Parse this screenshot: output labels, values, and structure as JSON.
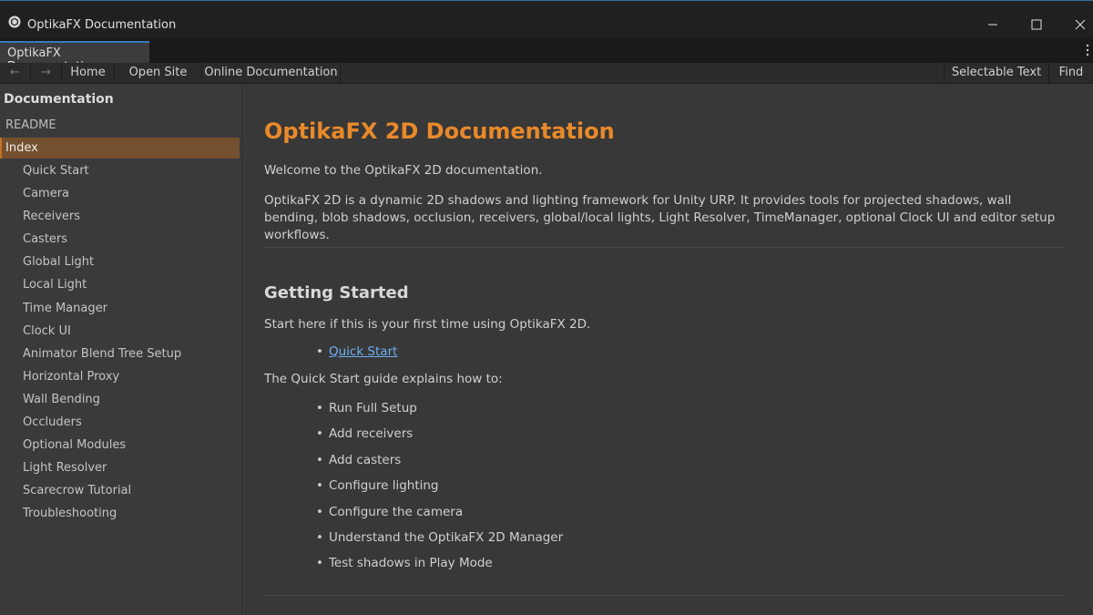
{
  "window": {
    "title": "OptikaFX Documentation",
    "icon": "unity-cube-icon"
  },
  "tab": {
    "label": "OptikaFX Documentation"
  },
  "toolbar": {
    "back_icon": "arrow-left-icon",
    "back_label": "←",
    "forward_icon": "arrow-right-icon",
    "forward_label": "→",
    "home_label": "Home",
    "open_site_label": "Open Site",
    "online_docs_label": "Online Documentation",
    "selectable_text_label": "Selectable Text",
    "find_label": "Find"
  },
  "sidebar": {
    "heading": "Documentation",
    "readme": "README",
    "selected": "Index",
    "items": [
      "Quick Start",
      "Camera",
      "Receivers",
      "Casters",
      "Global Light",
      "Local Light",
      "Time Manager",
      "Clock UI",
      "Animator Blend Tree Setup",
      "Horizontal Proxy",
      "Wall Bending",
      "Occluders",
      "Optional Modules",
      "Light Resolver",
      "Scarecrow Tutorial",
      "Troubleshooting"
    ]
  },
  "main": {
    "title": "OptikaFX 2D Documentation",
    "welcome": "Welcome to the OptikaFX 2D documentation.",
    "description": "OptikaFX 2D is a dynamic 2D shadows and lighting framework for Unity URP. It provides tools for projected shadows, wall bending, blob shadows, occlusion, receivers, global/local lights, Light Resolver, TimeManager, optional Clock UI and editor setup workflows.",
    "getting_started_heading": "Getting Started",
    "getting_started_text": "Start here if this is your first time using OptikaFX 2D.",
    "quick_start_link": "Quick Start",
    "guide_intro": "The Quick Start guide explains how to:",
    "steps": [
      "Run Full Setup",
      "Add receivers",
      "Add casters",
      "Configure lighting",
      "Configure the camera",
      "Understand the OptikaFX 2D Manager",
      "Test shadows in Play Mode"
    ]
  },
  "colors": {
    "accent": "#e8892a",
    "selection": "#74502e",
    "link": "#6db0f0"
  }
}
